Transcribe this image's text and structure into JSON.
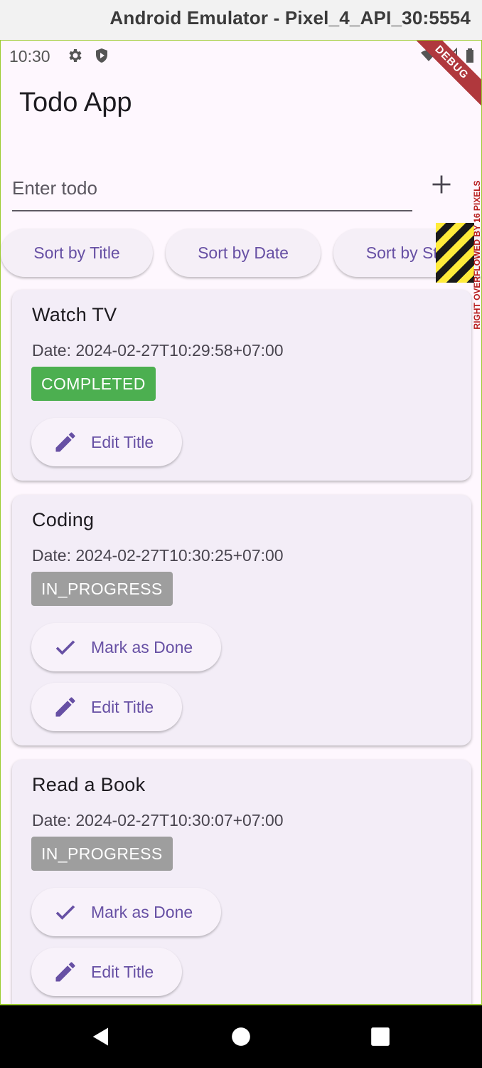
{
  "emulator": {
    "title": "Android Emulator - Pixel_4_API_30:5554"
  },
  "status_bar": {
    "time": "10:30",
    "debug_label": "DEBUG"
  },
  "app_bar": {
    "title": "Todo App"
  },
  "input": {
    "placeholder": "Enter todo",
    "value": ""
  },
  "sort_buttons": {
    "title": "Sort by Title",
    "date": "Sort by Date",
    "status": "Sort by Status"
  },
  "overflow_warning": "RIGHT OVERFLOWED BY 16 PIXELS",
  "todos": [
    {
      "title": "Watch TV",
      "date": "Date: 2024-02-27T10:29:58+07:00",
      "status": "COMPLETED",
      "edit_label": "Edit Title"
    },
    {
      "title": "Coding",
      "date": "Date: 2024-02-27T10:30:25+07:00",
      "status": "IN_PROGRESS",
      "mark_label": "Mark as Done",
      "edit_label": "Edit Title"
    },
    {
      "title": "Read a Book",
      "date": "Date: 2024-02-27T10:30:07+07:00",
      "status": "IN_PROGRESS",
      "mark_label": "Mark as Done",
      "edit_label": "Edit Title"
    }
  ],
  "colors": {
    "accent": "#6750a4",
    "completed": "#4caf50",
    "in_progress": "#9e9e9e",
    "card": "#f3edf7"
  }
}
